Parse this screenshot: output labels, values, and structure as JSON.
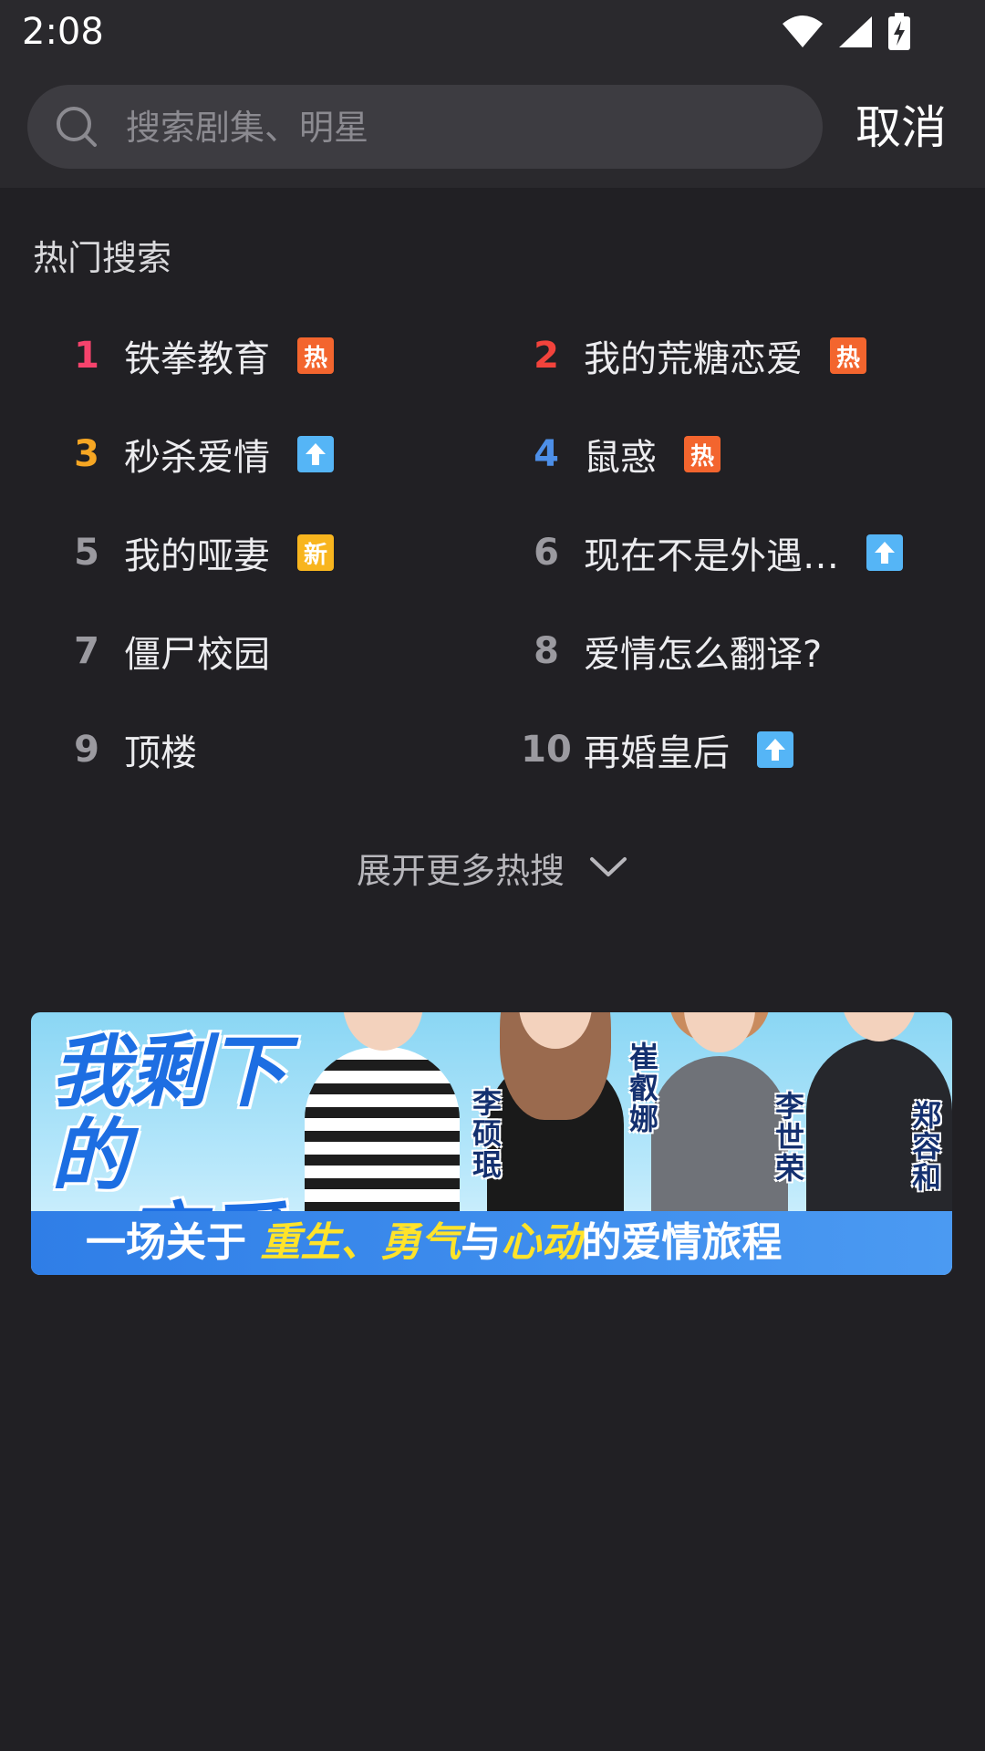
{
  "status": {
    "time": "2:08",
    "icons": [
      "wifi-icon",
      "signal-icon",
      "battery-charging-icon"
    ]
  },
  "search": {
    "placeholder": "搜索剧集、明星",
    "cancel_label": "取消"
  },
  "hot_search": {
    "title": "热门搜索",
    "items": [
      {
        "rank": "1",
        "title": "铁拳教育",
        "badge": "热",
        "badge_type": "hot"
      },
      {
        "rank": "2",
        "title": "我的荒糖恋爱",
        "badge": "热",
        "badge_type": "hot"
      },
      {
        "rank": "3",
        "title": "秒杀爱情",
        "badge": "up-arrow",
        "badge_type": "up"
      },
      {
        "rank": "4",
        "title": "鼠惑",
        "badge": "热",
        "badge_type": "hot"
      },
      {
        "rank": "5",
        "title": "我的哑妻",
        "badge": "新",
        "badge_type": "new"
      },
      {
        "rank": "6",
        "title": "现在不是外遇…",
        "badge": "up-arrow",
        "badge_type": "up"
      },
      {
        "rank": "7",
        "title": "僵尸校园",
        "badge": "",
        "badge_type": "none"
      },
      {
        "rank": "8",
        "title": "爱情怎么翻译?",
        "badge": "",
        "badge_type": "none"
      },
      {
        "rank": "9",
        "title": "顶楼",
        "badge": "",
        "badge_type": "none"
      },
      {
        "rank": "10",
        "title": "再婚皇后",
        "badge": "up-arrow",
        "badge_type": "up"
      }
    ],
    "expand_label": "展开更多热搜"
  },
  "banner": {
    "logo_line1": "我剩下的",
    "logo_line2": "恋爱",
    "tagline_pre": "一场关于",
    "tagline_hl1": "重生、勇气",
    "tagline_mid": "与",
    "tagline_hl2": "心动",
    "tagline_post": "的爱情旅程",
    "cast": [
      "李硕珉",
      "崔叡娜",
      "李世荣",
      "郑容和"
    ]
  },
  "colors": {
    "background": "#212024",
    "header": "#2a292d",
    "rank1": "#f5436c",
    "rank2": "#f2433c",
    "rank3": "#f6a623",
    "rank4": "#4d8fe8",
    "badge_hot": "#f3652e",
    "badge_new": "#f8b51e",
    "badge_up": "#55b5f6"
  }
}
